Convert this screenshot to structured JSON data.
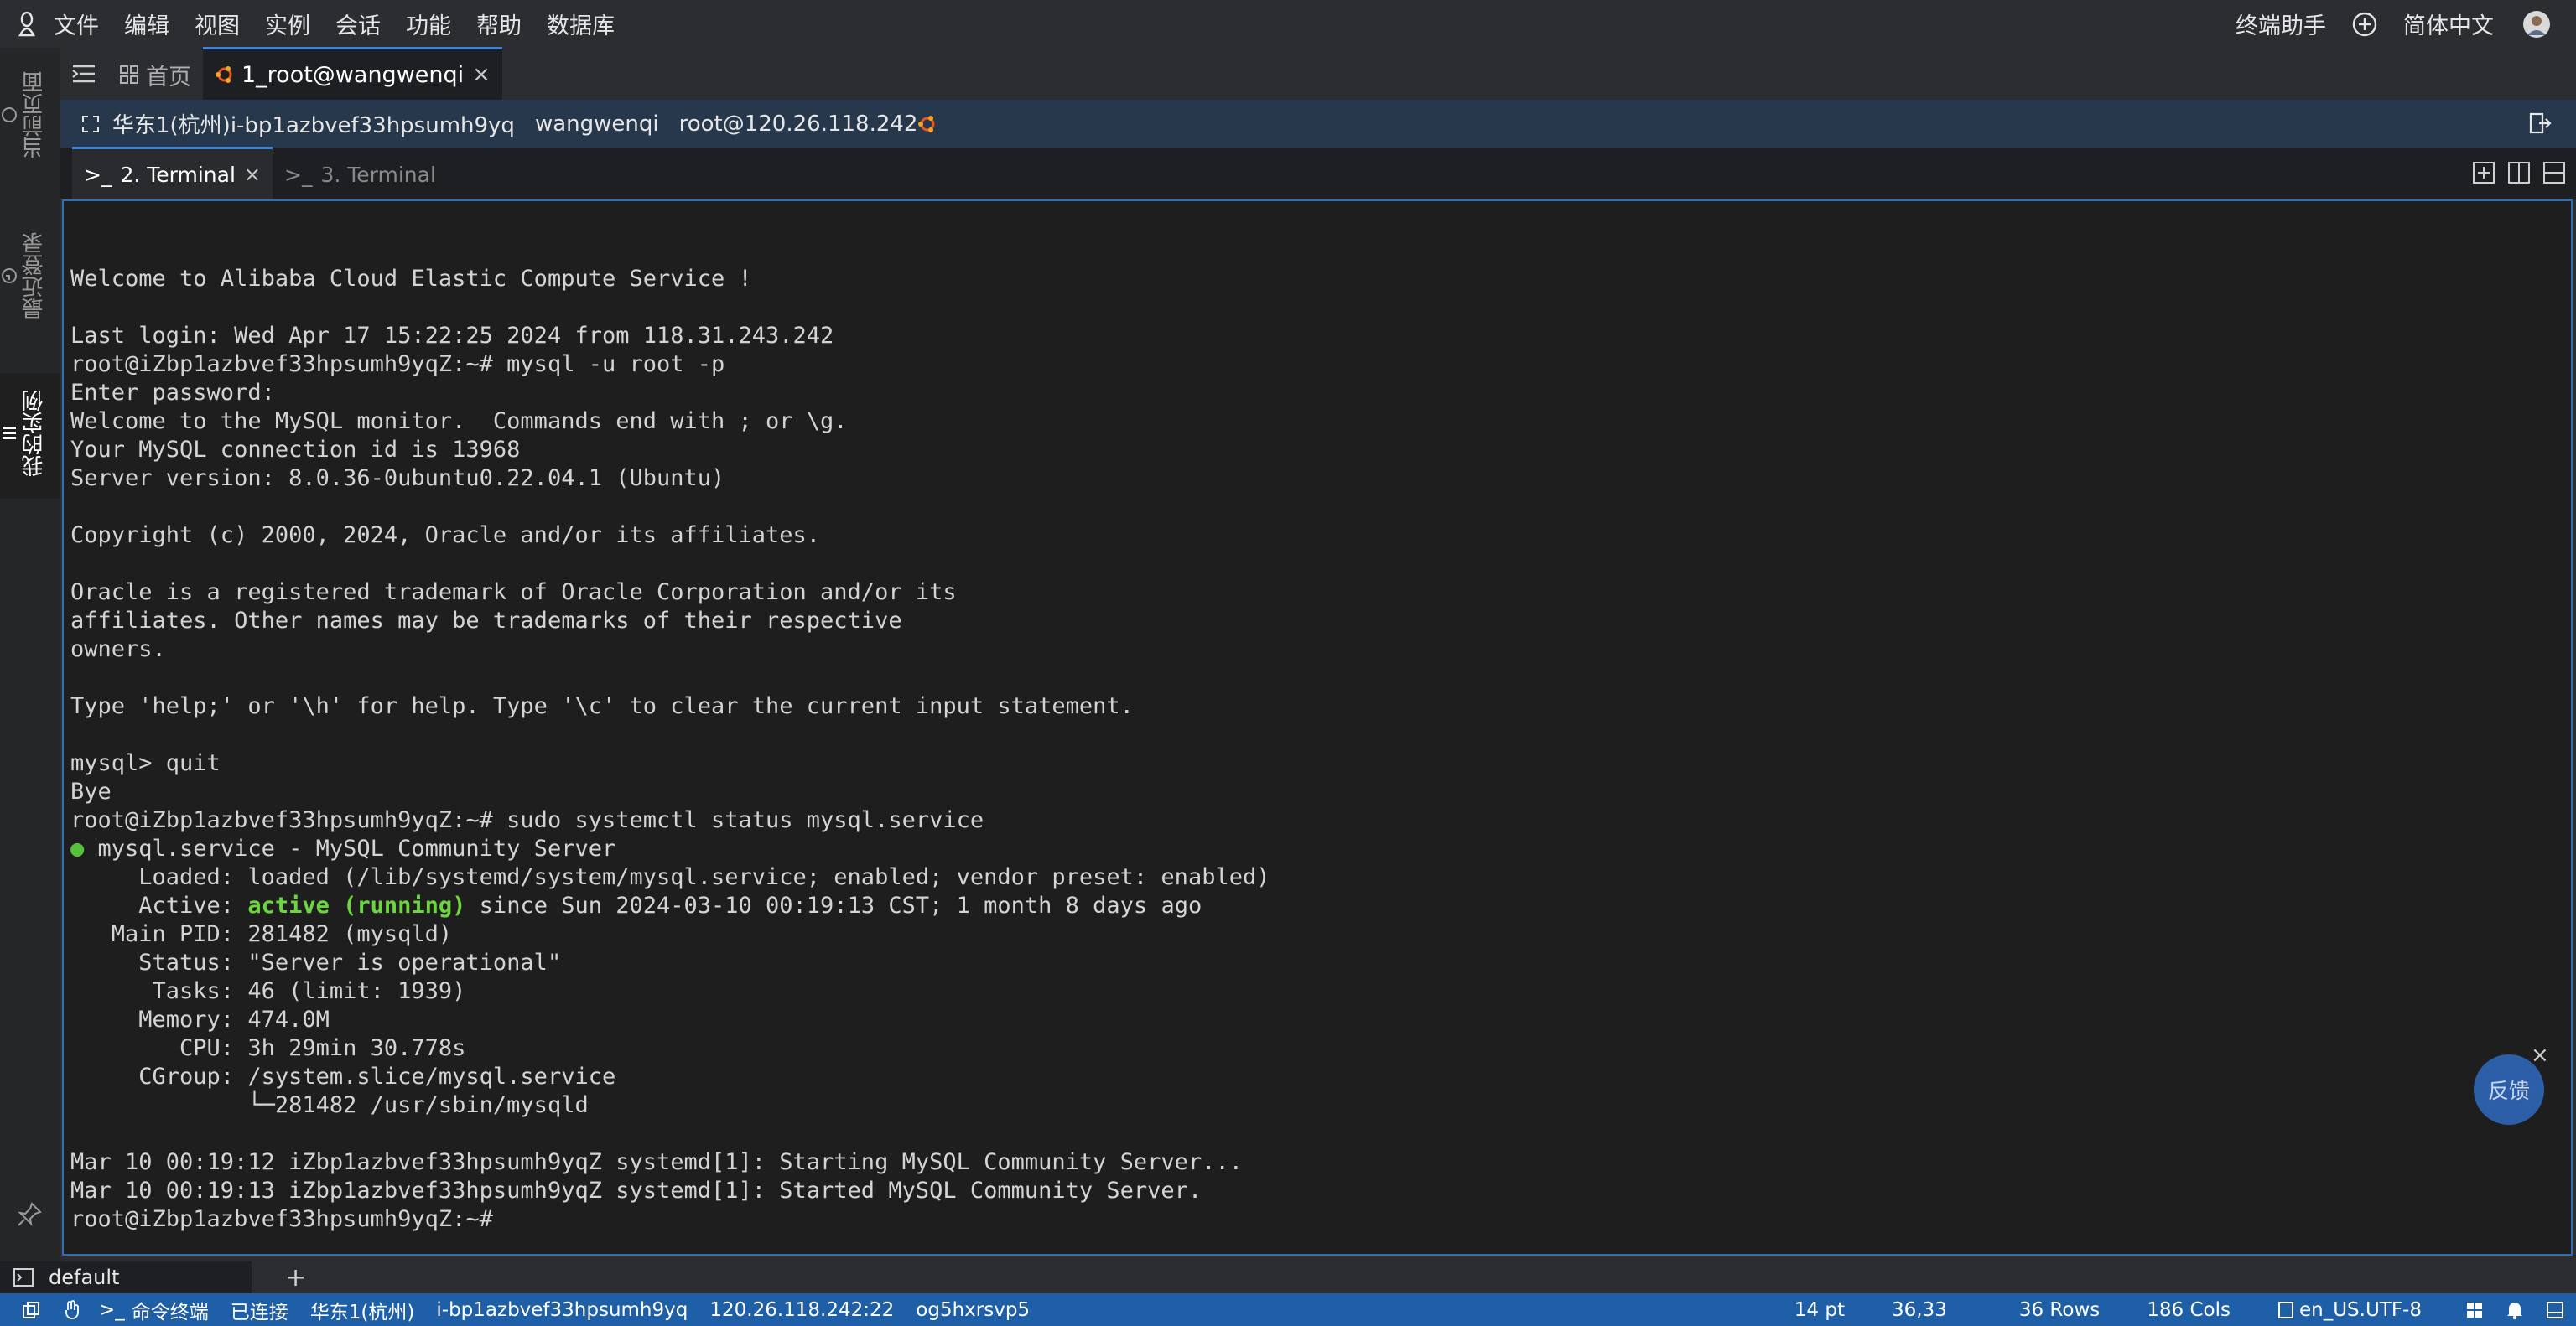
{
  "menubar": {
    "items": [
      "文件",
      "编辑",
      "视图",
      "实例",
      "会话",
      "功能",
      "帮助",
      "数据库"
    ],
    "assistant": "终端助手",
    "language": "简体中文"
  },
  "leftbar": {
    "tabs": [
      "当前页面",
      "最近登录",
      "我的实例"
    ]
  },
  "tabs": {
    "home": "首页",
    "session": "1_root@wangwenqi"
  },
  "infobar": {
    "instance": "华东1(杭州)i-bp1azbvef33hpsumh9yq",
    "name": "wangwenqi",
    "host": "root@120.26.118.242"
  },
  "terminal_tabs": [
    "2. Terminal",
    "3. Terminal"
  ],
  "terminal": {
    "lines_before": "Welcome to Alibaba Cloud Elastic Compute Service !\n\nLast login: Wed Apr 17 15:22:25 2024 from 118.31.243.242\nroot@iZbp1azbvef33hpsumh9yqZ:~# mysql -u root -p\nEnter password:\nWelcome to the MySQL monitor.  Commands end with ; or \\g.\nYour MySQL connection id is 13968\nServer version: 8.0.36-0ubuntu0.22.04.1 (Ubuntu)\n\nCopyright (c) 2000, 2024, Oracle and/or its affiliates.\n\nOracle is a registered trademark of Oracle Corporation and/or its\naffiliates. Other names may be trademarks of their respective\nowners.\n\nType 'help;' or '\\h' for help. Type '\\c' to clear the current input statement.\n\nmysql> quit\nBye\nroot@iZbp1azbvef33hpsumh9yqZ:~# sudo systemctl status mysql.service\n",
    "service_dot": "●",
    "service_line": " mysql.service - MySQL Community Server\n     Loaded: loaded (/lib/systemd/system/mysql.service; enabled; vendor preset: enabled)\n     Active: ",
    "active_state": "active (running)",
    "lines_after": " since Sun 2024-03-10 00:19:13 CST; 1 month 8 days ago\n   Main PID: 281482 (mysqld)\n     Status: \"Server is operational\"\n      Tasks: 46 (limit: 1939)\n     Memory: 474.0M\n        CPU: 3h 29min 30.778s\n     CGroup: /system.slice/mysql.service\n             └─281482 /usr/sbin/mysqld\n\nMar 10 00:19:12 iZbp1azbvef33hpsumh9yqZ systemd[1]: Starting MySQL Community Server...\nMar 10 00:19:13 iZbp1azbvef33hpsumh9yqZ systemd[1]: Started MySQL Community Server.\nroot@iZbp1azbvef33hpsumh9yqZ:~#"
  },
  "feedback": "反馈",
  "session_tab": "default",
  "statusbar": {
    "mode": "命令终端",
    "connected": "已连接",
    "region": "华东1(杭州)",
    "instance": "i-bp1azbvef33hpsumh9yq",
    "address": "120.26.118.242:22",
    "session_id": "og5hxrsvp5",
    "font_size": "14 pt",
    "cursor": "36,33",
    "rows": "36 Rows",
    "cols": "186 Cols",
    "encoding": "en_US.UTF-8"
  },
  "colors": {
    "accent": "#3d82d9",
    "status_bar": "#1f5fa8",
    "info_bar": "#27384c",
    "terminal_green": "#6bd63e"
  }
}
